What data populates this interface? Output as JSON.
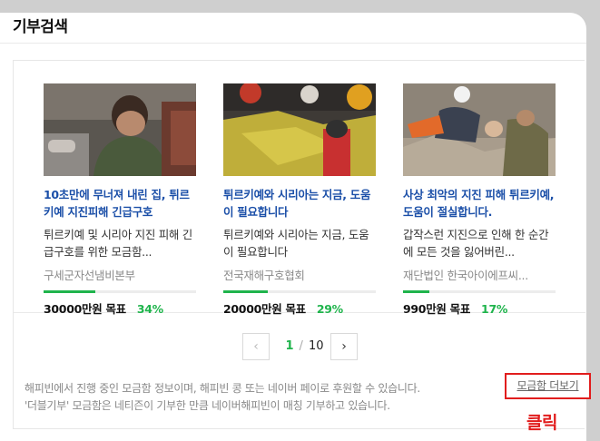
{
  "header": {
    "title": "기부검색"
  },
  "cards": [
    {
      "title": "10초만에 무너져 내린 집, 튀르키예 지진피해 긴급구호",
      "desc": "튀르키예 및 시리아 지진 피해 긴급구호를 위한 모금함...",
      "org": "구세군자선냄비본부",
      "goal": "30000만원 목표",
      "percent_text": "34%",
      "percent": 34
    },
    {
      "title": "튀르키예와 시리아는 지금, 도움이 필요합니다",
      "desc": "튀르키예와 시리아는 지금, 도움이 필요합니다",
      "org": "전국재해구호협회",
      "goal": "20000만원 목표",
      "percent_text": "29%",
      "percent": 29
    },
    {
      "title": "사상 최악의 지진 피해 튀르키예, 도움이 절실합니다.",
      "desc": "갑작스런 지진으로 인해 한 순간에 모든 것을 잃어버린...",
      "org": "재단법인 한국아이에프씨...",
      "goal": "990만원 목표",
      "percent_text": "17%",
      "percent": 17
    }
  ],
  "pagination": {
    "prev": "‹",
    "current": "1",
    "separator": "/",
    "total": "10",
    "next": "›"
  },
  "footer": {
    "line1": "해피빈에서 진행 중인 모금함 정보이며, 해피빈 콩 또는 네이버 페이로 후원할 수 있습니다.",
    "line2": "'더블기부' 모금함은 네티즌이 기부한 만큼 네이버해피빈이 매칭 기부하고 있습니다."
  },
  "more_button": "모금함 더보기",
  "annotation": "클릭",
  "colors": {
    "accent": "#1fb44c",
    "link": "#1b4fa8",
    "highlight": "#e11d1d"
  }
}
